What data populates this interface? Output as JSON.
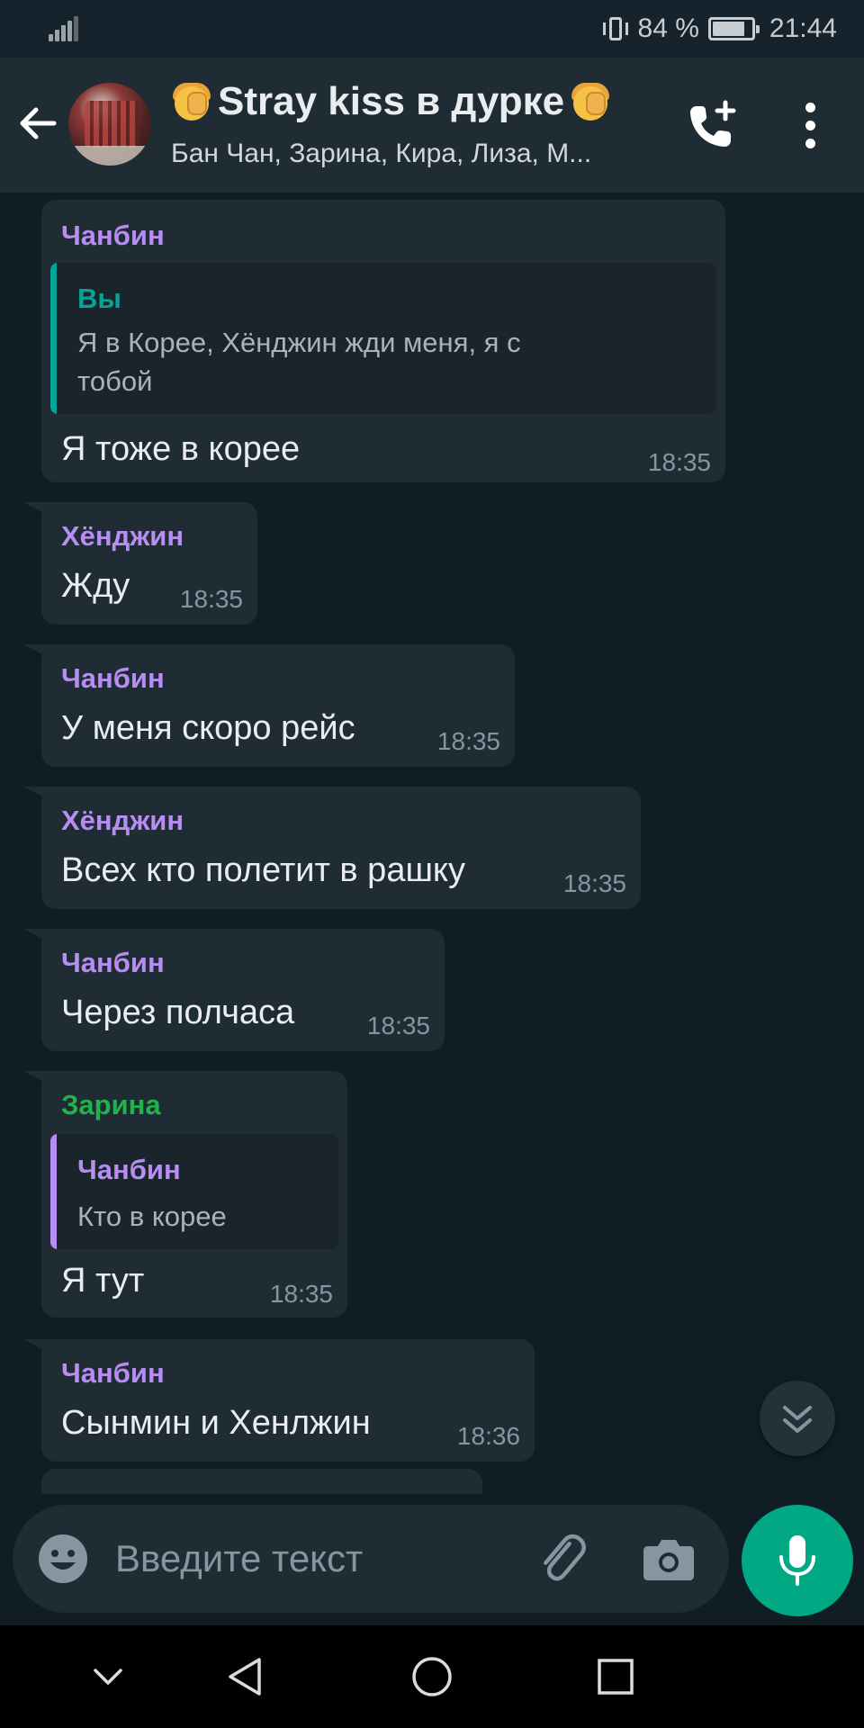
{
  "status_bar": {
    "battery_text": "84 %",
    "battery_level": 0.84,
    "time": "21:44",
    "icons": [
      "signal-icon",
      "vibrate-icon",
      "battery-icon"
    ]
  },
  "header": {
    "title": "Stray kiss в дурке",
    "subtitle": "Бан Чан, Зарина, Кира, Лиза, М...",
    "icons": [
      "back-arrow-icon",
      "group-avatar",
      "facepalm-emoji",
      "add-call-icon",
      "more-vert-icon"
    ]
  },
  "colors": {
    "background": "#101d25",
    "bubble": "#1f2c34",
    "name_purple": "#b78df3",
    "name_teal": "#06a398",
    "name_green": "#23b14d",
    "accent": "#00a884"
  },
  "messages": [
    {
      "sender": "Чанбин",
      "quote": {
        "sender": "Вы",
        "text_line1": "Я в Корее, Хёнджин жди меня, я с",
        "text_line2": "тобой"
      },
      "text": "Я тоже в корее",
      "time": "18:35"
    },
    {
      "sender": "Хёнджин",
      "text": "Жду",
      "time": "18:35"
    },
    {
      "sender": "Чанбин",
      "text": "У меня скоро рейс",
      "time": "18:35"
    },
    {
      "sender": "Хёнджин",
      "text": "Всех кто полетит в рашку",
      "time": "18:35"
    },
    {
      "sender": "Чанбин",
      "text": "Через полчаса",
      "time": "18:35"
    },
    {
      "sender": "Зарина",
      "quote": {
        "sender": "Чанбин",
        "text": "Кто в корее"
      },
      "text": "Я тут",
      "time": "18:35"
    },
    {
      "sender": "Чанбин",
      "text": "Сынмин и Хенлжин",
      "time": "18:36"
    }
  ],
  "composer": {
    "placeholder": "Введите текст",
    "icons": [
      "emoji-icon",
      "attach-icon",
      "camera-icon",
      "mic-icon",
      "scroll-down-icon"
    ]
  },
  "navbar": {
    "icons": [
      "collapse-icon",
      "back-nav-icon",
      "home-nav-icon",
      "recents-nav-icon"
    ]
  }
}
